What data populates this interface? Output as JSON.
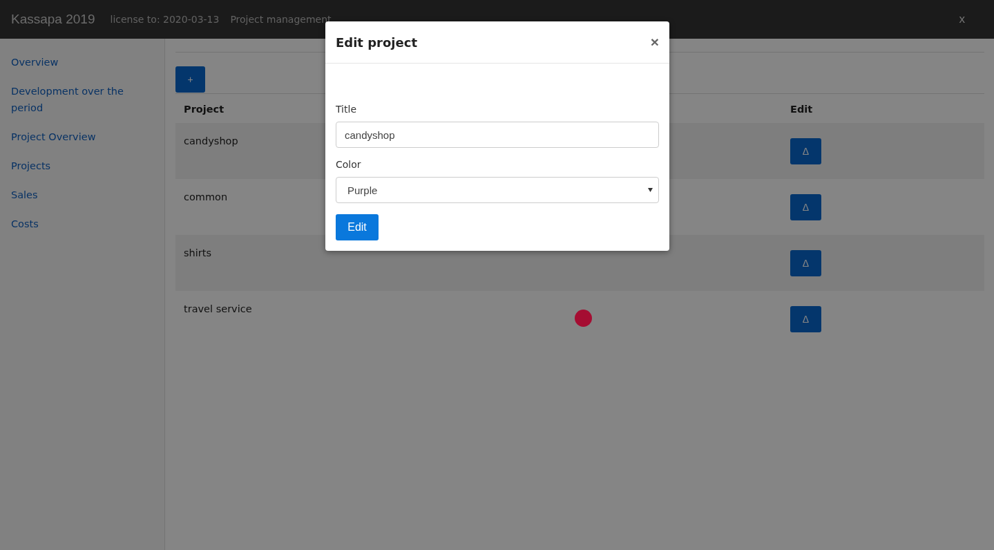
{
  "header": {
    "brand": "Kassapa 2019",
    "license": "license to: 2020-03-13",
    "section": "Project management",
    "close": "x"
  },
  "sidebar": {
    "items": [
      {
        "label": "Overview"
      },
      {
        "label": "Development over the period"
      },
      {
        "label": "Project Overview"
      },
      {
        "label": "Projects"
      },
      {
        "label": "Sales"
      },
      {
        "label": "Costs"
      }
    ]
  },
  "add_button": "+",
  "table": {
    "columns": [
      "Project",
      "Edit"
    ],
    "rows": [
      {
        "project": "candyshop",
        "edit": "Δ"
      },
      {
        "project": "common",
        "edit": "Δ"
      },
      {
        "project": "shirts",
        "edit": "Δ"
      },
      {
        "project": "travel service",
        "color": "#a50d32",
        "edit": "Δ"
      }
    ]
  },
  "modal": {
    "title": "Edit project",
    "close": "×",
    "fields": [
      {
        "kind": "text",
        "label": "Title",
        "value": "candyshop"
      },
      {
        "kind": "select",
        "label": "Color",
        "value": "Purple"
      }
    ],
    "submit": "Edit"
  }
}
